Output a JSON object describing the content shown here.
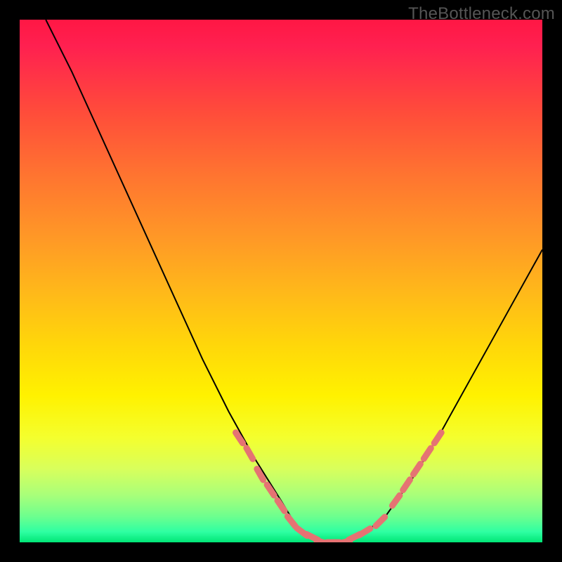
{
  "watermark": "TheBottleneck.com",
  "chart_data": {
    "type": "line",
    "title": "",
    "xlabel": "",
    "ylabel": "",
    "xlim": [
      0,
      100
    ],
    "ylim": [
      0,
      100
    ],
    "series": [
      {
        "name": "bottleneck-curve",
        "x": [
          5,
          10,
          15,
          20,
          25,
          30,
          35,
          40,
          45,
          50,
          53,
          56,
          59,
          62,
          65,
          70,
          75,
          80,
          85,
          90,
          95,
          100
        ],
        "y": [
          100,
          90,
          79,
          68,
          57,
          46,
          35,
          25,
          16,
          8,
          3,
          1,
          0,
          0,
          1,
          5,
          12,
          20,
          29,
          38,
          47,
          56
        ]
      }
    ],
    "markers": {
      "name": "highlight-dashes",
      "color": "#e57373",
      "points": [
        {
          "x": 42,
          "y": 20
        },
        {
          "x": 44,
          "y": 17
        },
        {
          "x": 46,
          "y": 13
        },
        {
          "x": 48,
          "y": 10
        },
        {
          "x": 50,
          "y": 7
        },
        {
          "x": 52,
          "y": 4
        },
        {
          "x": 54,
          "y": 2
        },
        {
          "x": 56,
          "y": 1
        },
        {
          "x": 58,
          "y": 0
        },
        {
          "x": 60,
          "y": 0
        },
        {
          "x": 62,
          "y": 0
        },
        {
          "x": 64,
          "y": 1
        },
        {
          "x": 66,
          "y": 2
        },
        {
          "x": 69,
          "y": 4
        },
        {
          "x": 72,
          "y": 8
        },
        {
          "x": 74,
          "y": 11
        },
        {
          "x": 76,
          "y": 14
        },
        {
          "x": 78,
          "y": 17
        },
        {
          "x": 80,
          "y": 20
        }
      ]
    },
    "gradient_stops": [
      {
        "pos": 0,
        "color": "#ff1744"
      },
      {
        "pos": 50,
        "color": "#ffd60a"
      },
      {
        "pos": 100,
        "color": "#00e676"
      }
    ]
  }
}
